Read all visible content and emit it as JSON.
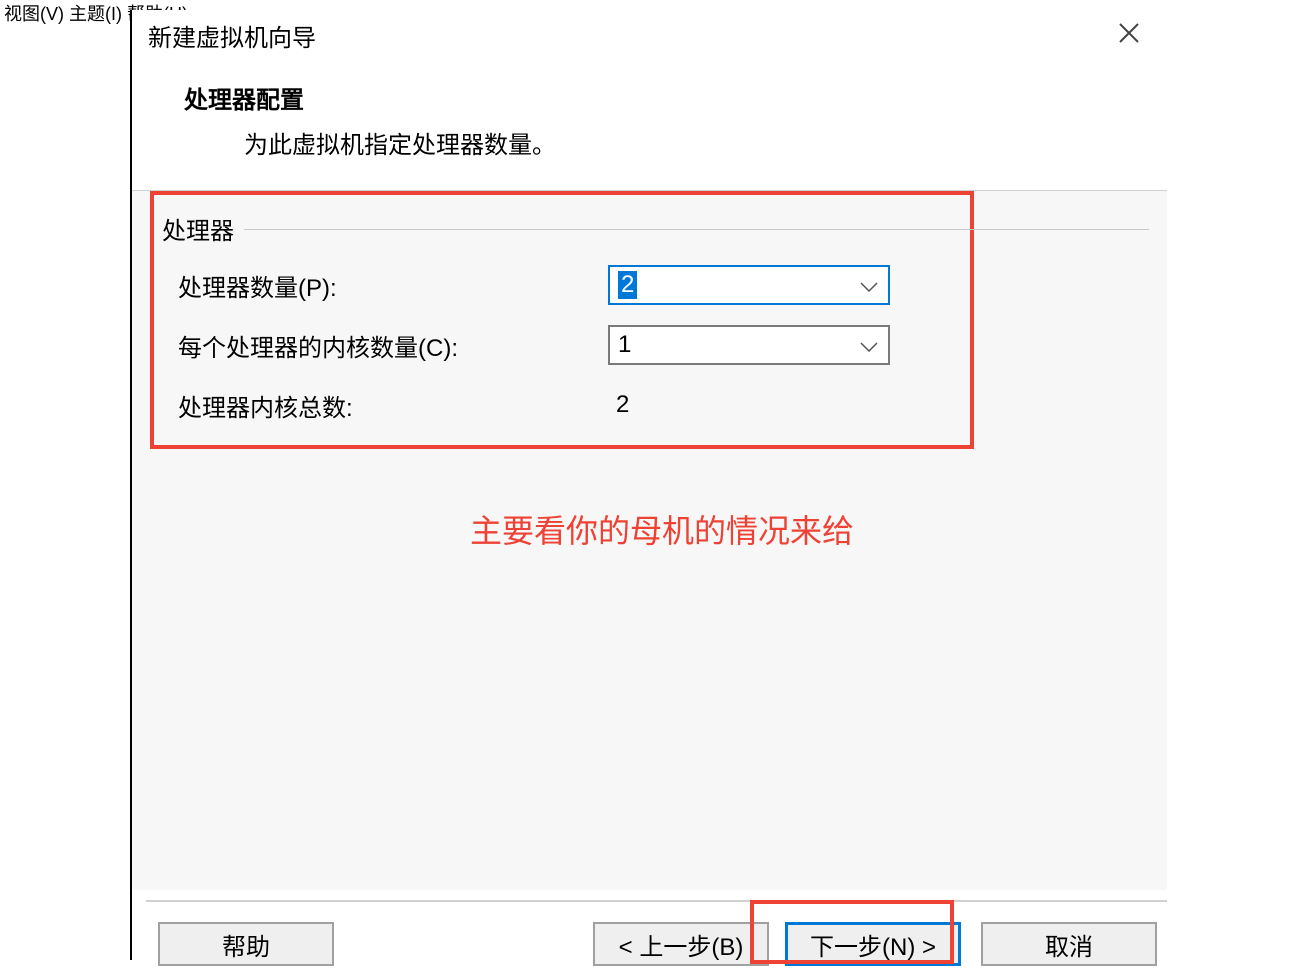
{
  "menu_bar": "  视图(V)  主题(I)  帮助(H)",
  "dialog": {
    "title": "新建虚拟机向导",
    "header": {
      "title": "处理器配置",
      "subtitle": "为此虚拟机指定处理器数量。"
    },
    "fieldset_legend": "处理器",
    "rows": {
      "processors": {
        "label": "处理器数量(P):",
        "value": "2"
      },
      "cores": {
        "label": "每个处理器的内核数量(C):",
        "value": "1"
      },
      "total": {
        "label": "处理器内核总数:",
        "value": "2"
      }
    },
    "annotation": "主要看你的母机的情况来给",
    "buttons": {
      "help": "帮助",
      "back": "< 上一步(B)",
      "next": "下一步(N) >",
      "cancel": "取消"
    }
  }
}
